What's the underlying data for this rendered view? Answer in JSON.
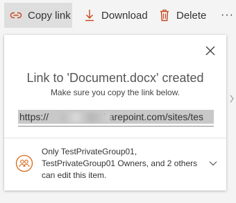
{
  "toolbar": {
    "copy_link": {
      "label": "Copy link",
      "icon": "link-icon"
    },
    "download": {
      "label": "Download",
      "icon": "download-icon"
    },
    "delete": {
      "label": "Delete",
      "icon": "trash-icon"
    },
    "more": {
      "label": "···",
      "icon": "more-icon"
    }
  },
  "dialog": {
    "title": "Link to 'Document.docx' created",
    "subtitle": "Make sure you copy the link below.",
    "link_prefix": "https://",
    "link_suffix": "sharepoint.com/sites/tes",
    "permission_text": "Only TestPrivateGroup01, TestPrivateGroup01 Owners, and 2 others can edit this item."
  },
  "colors": {
    "accent_orange": "#d86b1b",
    "download_icon": "#c7451b",
    "delete_icon": "#c7451b",
    "link_icon": "#c7451b",
    "selection": "#c8c8c8"
  }
}
